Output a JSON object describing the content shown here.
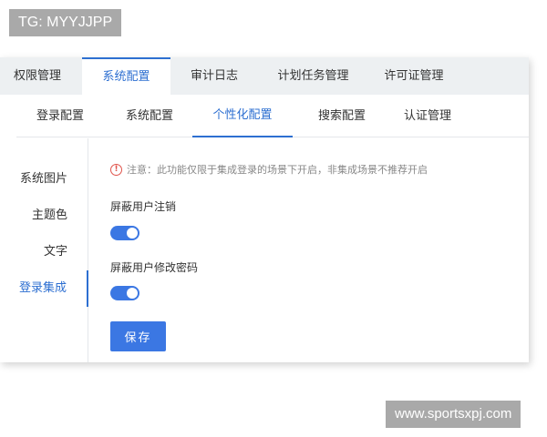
{
  "watermark": {
    "top": "TG: MYYJJPP",
    "bottom": "www.sportsxpj.com"
  },
  "main_tabs": [
    {
      "label": "权限管理"
    },
    {
      "label": "系统配置",
      "active": true
    },
    {
      "label": "审计日志"
    },
    {
      "label": "计划任务管理"
    },
    {
      "label": "许可证管理"
    }
  ],
  "sub_tabs": [
    {
      "label": "登录配置"
    },
    {
      "label": "系统配置"
    },
    {
      "label": "个性化配置",
      "active": true
    },
    {
      "label": "搜索配置"
    },
    {
      "label": "认证管理"
    }
  ],
  "side_nav": [
    {
      "label": "系统图片"
    },
    {
      "label": "主题色"
    },
    {
      "label": "文字"
    },
    {
      "label": "登录集成",
      "active": true
    }
  ],
  "content": {
    "notice": "注意：此功能仅限于集成登录的场景下开启，非集成场景不推荐开启",
    "notice_icon": "warning-circle-icon",
    "setting1": {
      "label": "屏蔽用户注销",
      "enabled": true
    },
    "setting2": {
      "label": "屏蔽用户修改密码",
      "enabled": true
    },
    "save_label": "保存"
  },
  "colors": {
    "accent": "#3b77e3",
    "active_text": "#2d6fd1",
    "warning": "#e0534b",
    "tabbar_bg": "#edf0f2"
  }
}
